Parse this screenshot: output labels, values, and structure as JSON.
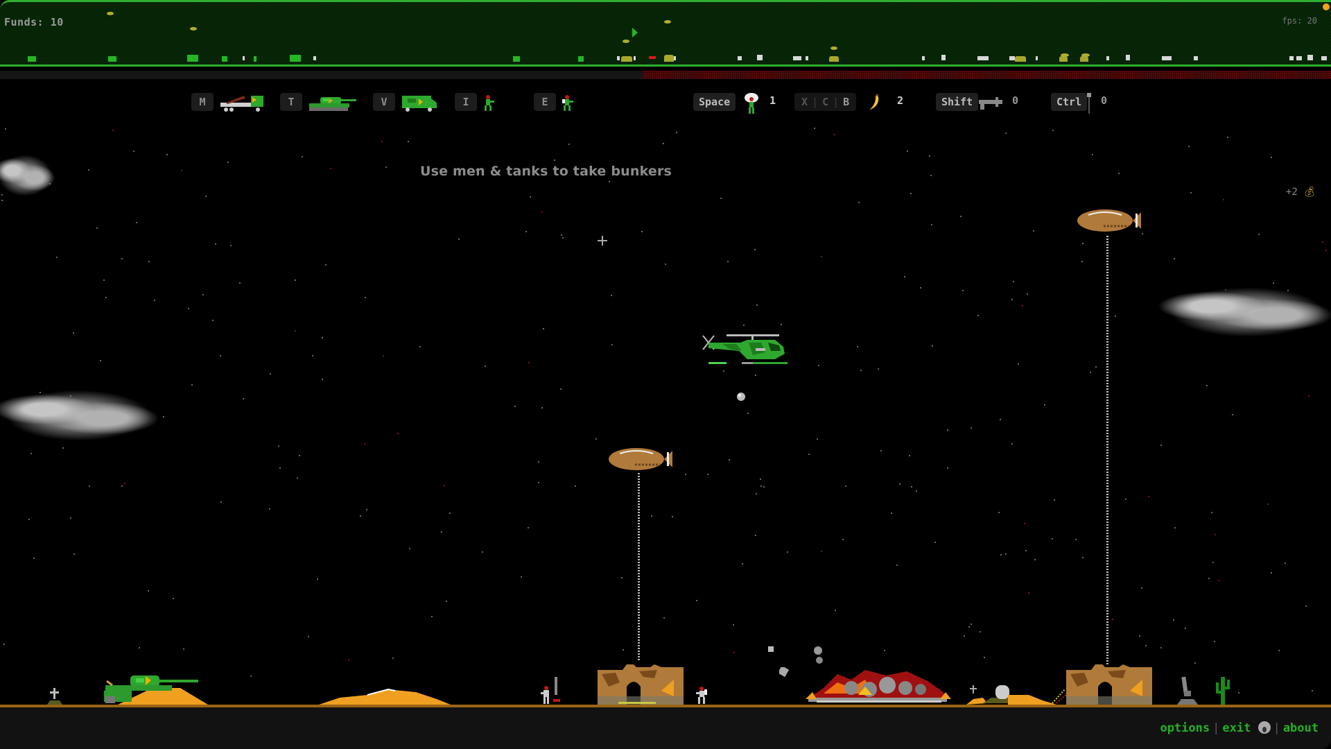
{
  "hud": {
    "funds_label": "Funds: 10",
    "fps_label": "fps: 20",
    "enemy_progress_fraction": 0.517
  },
  "toolbar": {
    "build_items": [
      {
        "key": "M",
        "unit": "missile-launcher"
      },
      {
        "key": "T",
        "unit": "tank"
      },
      {
        "key": "V",
        "unit": "van"
      },
      {
        "key": "I",
        "unit": "infantry"
      },
      {
        "key": "E",
        "unit": "engineer"
      }
    ],
    "paratrooper": {
      "key": "Space",
      "count": "1"
    },
    "bombs": {
      "keys": [
        "X",
        "C",
        "B"
      ],
      "count": "2"
    },
    "smart_missile": {
      "key": "Shift",
      "count": "0"
    },
    "parachute_infantry": {
      "key": "Ctrl",
      "count": "0"
    }
  },
  "game": {
    "message": "Use men & tanks to take bunkers",
    "bonus": "+2",
    "bonus_icon": "money-bag-icon"
  },
  "footer": {
    "options_label": "options",
    "exit_label": "exit",
    "about_label": "about",
    "separator": "|"
  },
  "colors": {
    "radar_border": "#2fae2f",
    "radar_bg": "#082a08",
    "ground": "#9a6414",
    "link": "#22b022",
    "enemy_bar": "#5a0a0a"
  }
}
